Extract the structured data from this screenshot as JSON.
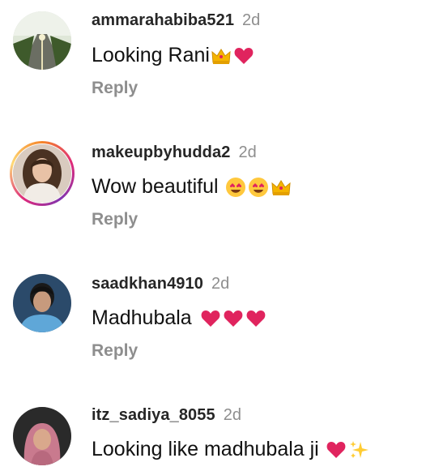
{
  "comments": [
    {
      "username": "ammarahabiba521",
      "time": "2d",
      "text": "Looking Rani",
      "emojis": [
        "crown",
        "red-heart"
      ],
      "reply_label": "Reply",
      "story_ring": false
    },
    {
      "username": "makeupbyhudda2",
      "time": "2d",
      "text": "Wow beautiful",
      "emojis": [
        "heart-eyes",
        "heart-eyes",
        "crown"
      ],
      "reply_label": "Reply",
      "story_ring": true
    },
    {
      "username": "saadkhan4910",
      "time": "2d",
      "text": "Madhubala",
      "emojis": [
        "red-heart",
        "red-heart",
        "red-heart"
      ],
      "reply_label": "Reply",
      "story_ring": false
    },
    {
      "username": "itz_sadiya_8055",
      "time": "2d",
      "text": "Looking like madhubala ji",
      "emojis": [
        "red-heart",
        "sparkles"
      ],
      "story_ring": false
    }
  ],
  "colors": {
    "username": "#262626",
    "secondary": "#8e8e8e",
    "heart": "#e0245e"
  }
}
